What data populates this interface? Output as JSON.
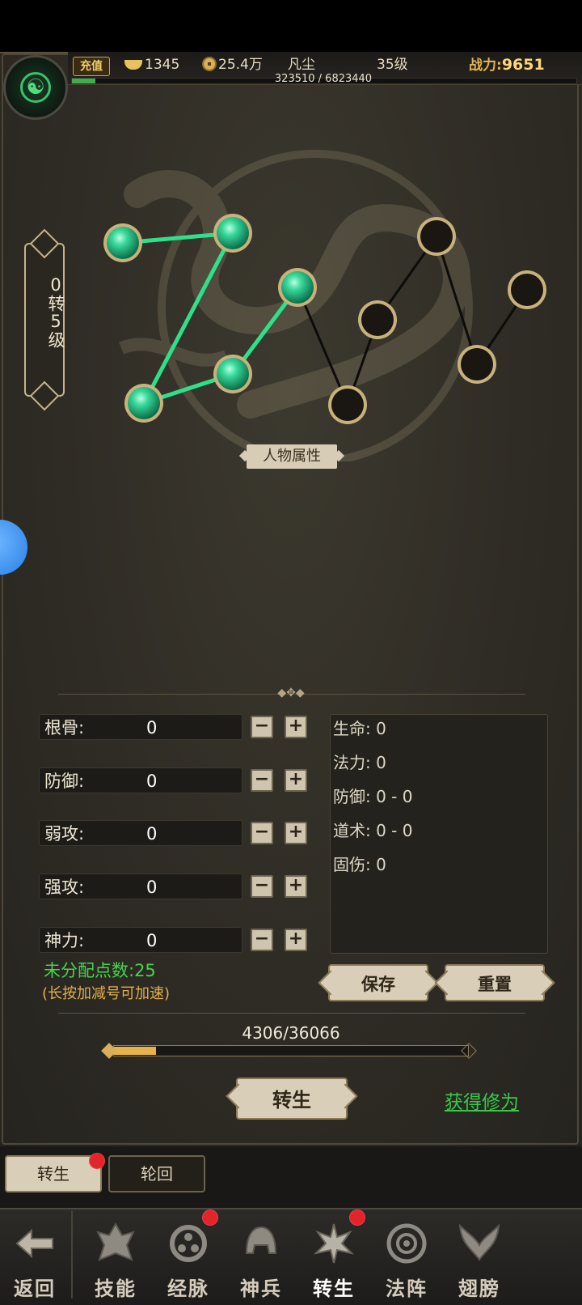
{
  "header": {
    "recharge_label": "充值",
    "ingot": "1345",
    "coins": "25.4万",
    "realm": "凡尘",
    "level": "35级",
    "power_label": "战力:",
    "power_value": "9651",
    "exp_text": "323510 / 6823440",
    "exp_fraction": 0.047
  },
  "rebirth_level": "0转5级",
  "constellation": {
    "lit_nodes": 5,
    "total_nodes": 11
  },
  "attr_section_label": "人物属性",
  "stats": [
    {
      "name": "根骨:",
      "value": "0"
    },
    {
      "name": "防御:",
      "value": "0"
    },
    {
      "name": "弱攻:",
      "value": "0"
    },
    {
      "name": "强攻:",
      "value": "0"
    },
    {
      "name": "神力:",
      "value": "0"
    }
  ],
  "attributes": [
    "生命: 0",
    "法力: 0",
    "防御: 0 - 0",
    "道术: 0 - 0",
    "固伤: 0"
  ],
  "unassigned_label": "未分配点数:25",
  "hint": "(长按加减号可加速)",
  "buttons": {
    "save": "保存",
    "reset": "重置",
    "rebirth": "转生",
    "gain": "获得修为"
  },
  "progress": {
    "text": "4306/36066",
    "fraction": 0.119
  },
  "subtabs": [
    {
      "label": "转生",
      "active": true,
      "badge": true
    },
    {
      "label": "轮回",
      "active": false,
      "badge": false
    }
  ],
  "nav": {
    "back": "返回",
    "items": [
      {
        "label": "技能",
        "badge": false
      },
      {
        "label": "经脉",
        "badge": true
      },
      {
        "label": "神兵",
        "badge": false
      },
      {
        "label": "转生",
        "badge": true,
        "active": true
      },
      {
        "label": "法阵",
        "badge": false
      },
      {
        "label": "翅膀",
        "badge": false
      }
    ]
  },
  "colors": {
    "accent_green": "#47d34f",
    "gold": "#e3b04a",
    "badge_red": "#e3242b"
  }
}
